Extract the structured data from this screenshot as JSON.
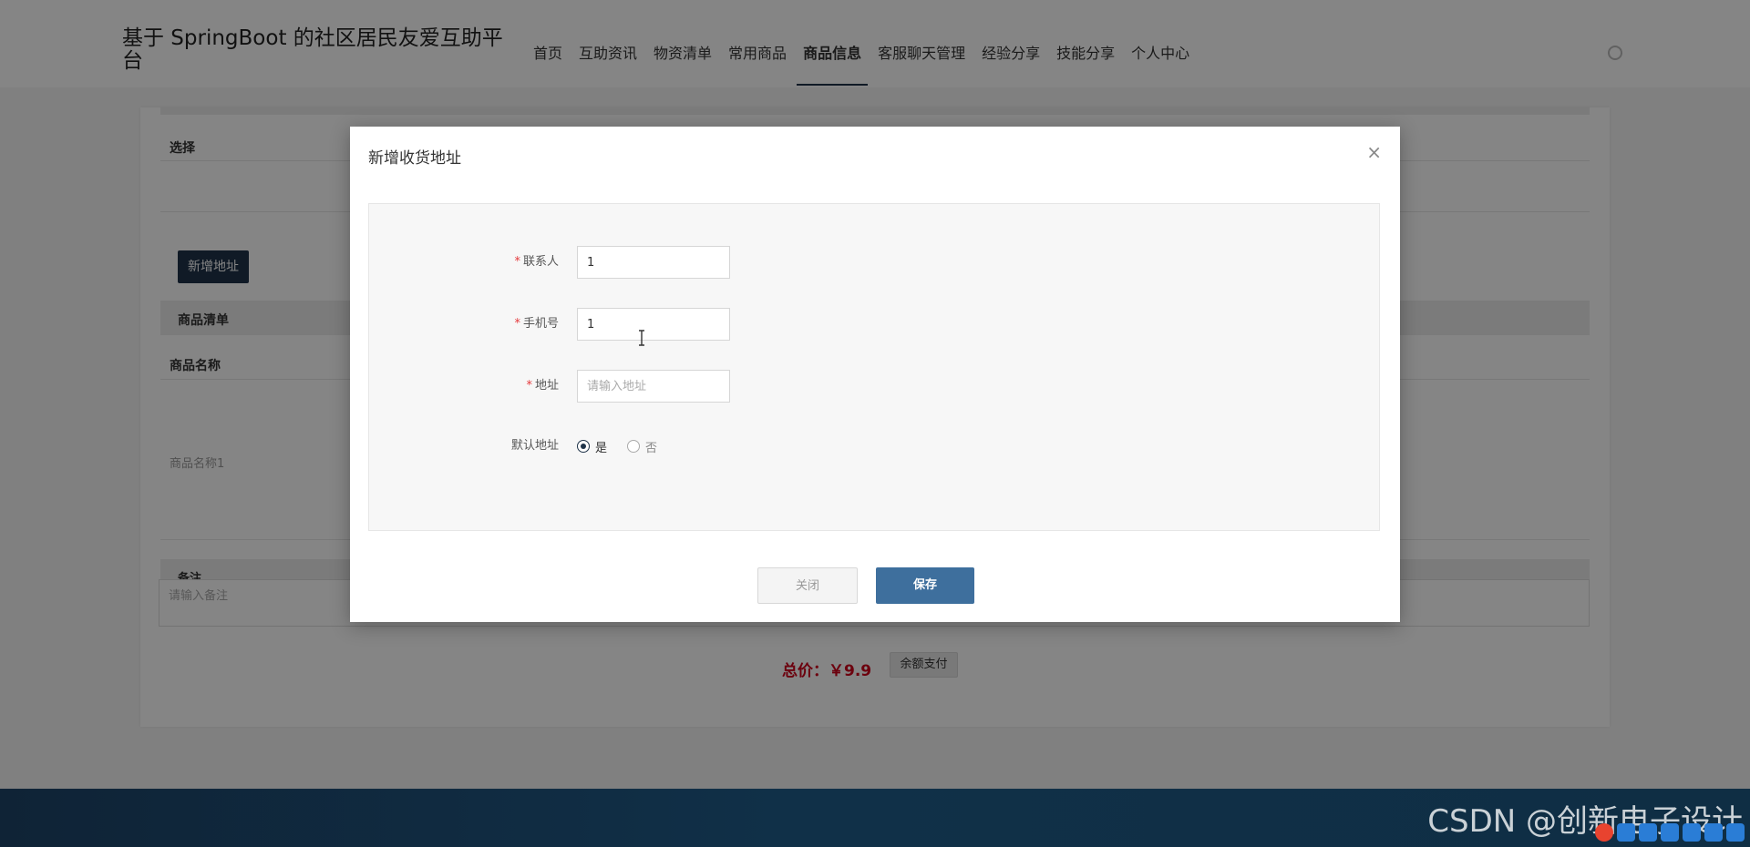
{
  "header": {
    "site_title": "基于 SpringBoot 的社区居民友爱互助平台",
    "nav": [
      {
        "label": "首页",
        "active": false
      },
      {
        "label": "互助资讯",
        "active": false
      },
      {
        "label": "物资清单",
        "active": false
      },
      {
        "label": "常用商品",
        "active": false
      },
      {
        "label": "商品信息",
        "active": true
      },
      {
        "label": "客服聊天管理",
        "active": false
      },
      {
        "label": "经验分享",
        "active": false
      },
      {
        "label": "技能分享",
        "active": false
      },
      {
        "label": "个人中心",
        "active": false
      }
    ]
  },
  "background": {
    "select_header": "选择",
    "add_address_button": "新增地址",
    "goods_list_header": "商品清单",
    "goods_name_header": "商品名称",
    "goods_name_value": "商品名称1",
    "remark_header": "备注",
    "remark_placeholder": "请输入备注",
    "total_label": "总价：",
    "total_value": "￥9.9",
    "pay_button": "余额支付"
  },
  "modal": {
    "title": "新增收货地址",
    "close_icon": "close-icon",
    "fields": {
      "contact": {
        "label": "联系人",
        "required": true,
        "value": "1",
        "placeholder": ""
      },
      "phone": {
        "label": "手机号",
        "required": true,
        "value": "1",
        "placeholder": ""
      },
      "address": {
        "label": "地址",
        "required": true,
        "value": "",
        "placeholder": "请输入地址"
      },
      "default_address": {
        "label": "默认地址",
        "options": [
          "是",
          "否"
        ],
        "selected": "是"
      }
    },
    "close_button": "关闭",
    "save_button": "保存"
  },
  "taskbar": {
    "watermark": "CSDN @创新电子设计"
  },
  "colors": {
    "primary_dark": "#1f3349",
    "save_blue": "#3e6f9d",
    "price_red": "#d0021b",
    "required_red": "#e4393c"
  }
}
